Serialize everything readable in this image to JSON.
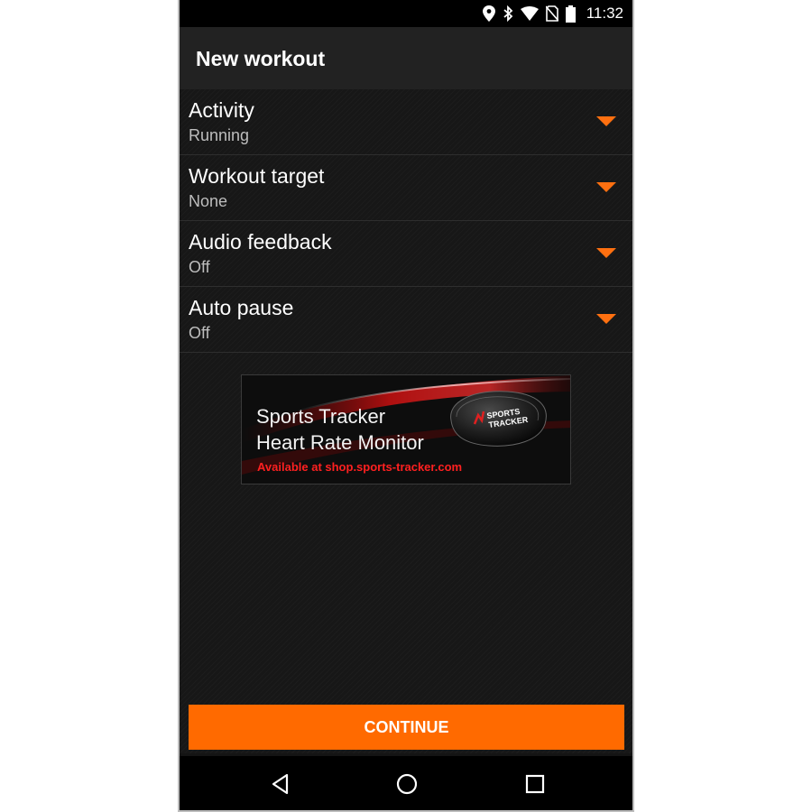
{
  "status_bar": {
    "time": "11:32",
    "icons": [
      "location-icon",
      "bluetooth-icon",
      "wifi-icon",
      "no-sim-icon",
      "battery-icon"
    ]
  },
  "app_bar": {
    "title": "New workout"
  },
  "settings": [
    {
      "label": "Activity",
      "value": "Running"
    },
    {
      "label": "Workout target",
      "value": "None"
    },
    {
      "label": "Audio feedback",
      "value": "Off"
    },
    {
      "label": "Auto pause",
      "value": "Off"
    }
  ],
  "banner": {
    "line1": "Sports Tracker",
    "line2": "Heart Rate Monitor",
    "link": "Available at shop.sports-tracker.com"
  },
  "continue_button": {
    "label": "CONTINUE"
  },
  "nav_bar": {
    "icons": [
      "back-icon",
      "home-icon",
      "recents-icon"
    ]
  },
  "colors": {
    "accent": "#ff6a00",
    "arrow": "#ff7010",
    "banner_link": "#ff2020",
    "background": "#171717",
    "app_bar": "#222222"
  }
}
